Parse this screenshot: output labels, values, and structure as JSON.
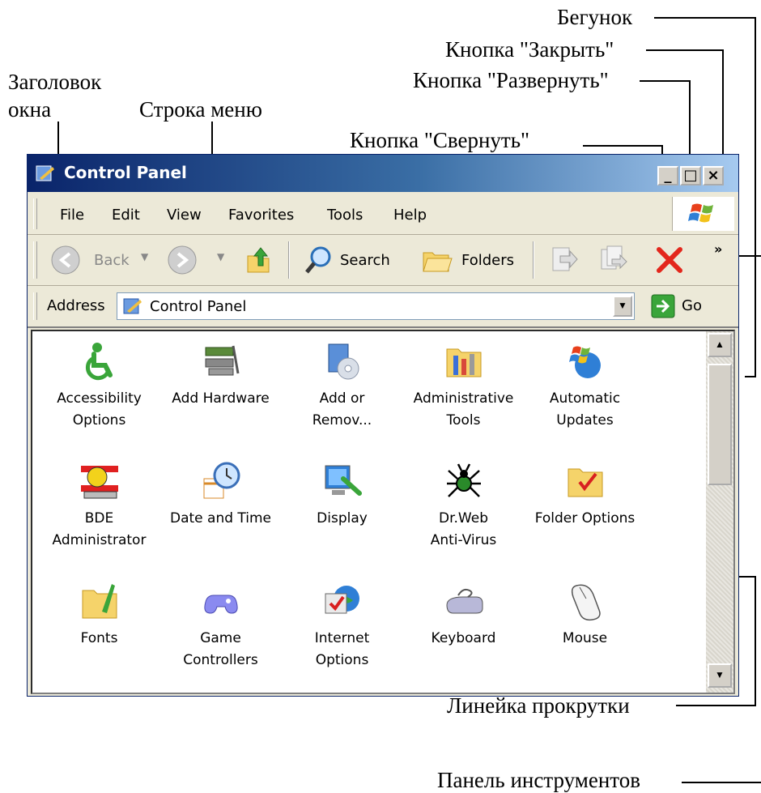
{
  "annotations": {
    "slider": "Бегунок",
    "close_button": "Кнопка \"Закрыть\"",
    "maximize_button": "Кнопка \"Развернуть\"",
    "title_line1": "Заголовок",
    "title_line2": "окна",
    "menu_bar": "Строка меню",
    "minimize_button": "Кнопка \"Свернуть\"",
    "scroll_bar": "Линейка прокрутки",
    "toolbar": "Панель инструментов"
  },
  "window": {
    "title": "Control Panel",
    "title_gradient": [
      "#0a246a",
      "#a6caf0"
    ]
  },
  "menu": {
    "items": [
      "File",
      "Edit",
      "View",
      "Favorites",
      "Tools",
      "Help"
    ]
  },
  "toolbar": {
    "back_label": "Back",
    "search_label": "Search",
    "folders_label": "Folders",
    "more": "»"
  },
  "address": {
    "label": "Address",
    "value": "Control Panel",
    "go_label": "Go"
  },
  "items": [
    {
      "icon": "accessibility-icon",
      "line1": "Accessibility",
      "line2": "Options"
    },
    {
      "icon": "add-hardware-icon",
      "line1": "Add Hardware",
      "line2": ""
    },
    {
      "icon": "add-remove-icon",
      "line1": "Add or",
      "line2": "Remov..."
    },
    {
      "icon": "admin-tools-icon",
      "line1": "Administrative",
      "line2": "Tools"
    },
    {
      "icon": "automatic-updates-icon",
      "line1": "Automatic",
      "line2": "Updates"
    },
    {
      "icon": "bde-admin-icon",
      "line1": "BDE",
      "line2": "Administrator"
    },
    {
      "icon": "date-time-icon",
      "line1": "Date and Time",
      "line2": ""
    },
    {
      "icon": "display-icon",
      "line1": "Display",
      "line2": ""
    },
    {
      "icon": "drweb-icon",
      "line1": "Dr.Web",
      "line2": "Anti-Virus"
    },
    {
      "icon": "folder-options-icon",
      "line1": "Folder Options",
      "line2": ""
    },
    {
      "icon": "fonts-icon",
      "line1": "Fonts",
      "line2": ""
    },
    {
      "icon": "game-controllers-icon",
      "line1": "Game",
      "line2": "Controllers"
    },
    {
      "icon": "internet-options-icon",
      "line1": "Internet",
      "line2": "Options"
    },
    {
      "icon": "keyboard-icon",
      "line1": "Keyboard",
      "line2": ""
    },
    {
      "icon": "mouse-icon",
      "line1": "Mouse",
      "line2": ""
    }
  ]
}
